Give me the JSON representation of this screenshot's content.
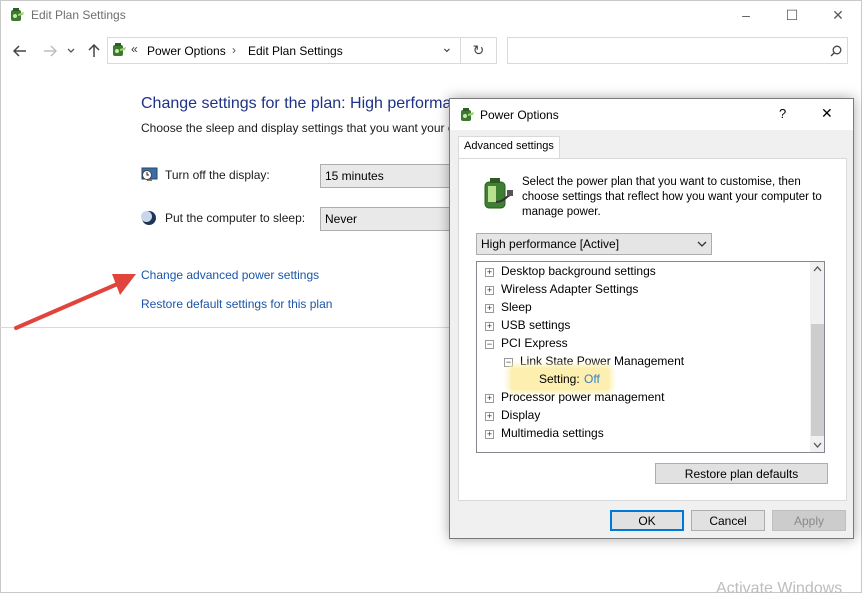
{
  "window": {
    "title": "Edit Plan Settings",
    "controls": {
      "minimize": "–",
      "maximize": "☐",
      "close": "✕"
    }
  },
  "addressbar": {
    "overflow": "«",
    "crumbs": [
      "Power Options",
      "Edit Plan Settings"
    ],
    "sep": "›",
    "dropdown": "⌄",
    "refresh": "↻",
    "search_placeholder": ""
  },
  "main": {
    "heading": "Change settings for the plan: High performance",
    "subtext": "Choose the sleep and display settings that you want your computer to use.",
    "display": {
      "label": "Turn off the display:",
      "value": "15 minutes"
    },
    "sleep": {
      "label": "Put the computer to sleep:",
      "value": "Never"
    },
    "links": {
      "advanced": "Change advanced power settings",
      "restore": "Restore default settings for this plan"
    }
  },
  "dialog": {
    "title": "Power Options",
    "help": "?",
    "close": "✕",
    "tab": "Advanced settings",
    "intro": "Select the power plan that you want to customise, then choose settings that reflect how you want your computer to manage power.",
    "plan_select": "High performance [Active]",
    "tree": [
      {
        "label": "Desktop background settings",
        "state": "+"
      },
      {
        "label": "Wireless Adapter Settings",
        "state": "+"
      },
      {
        "label": "Sleep",
        "state": "+"
      },
      {
        "label": "USB settings",
        "state": "+"
      },
      {
        "label": "PCI Express",
        "state": "−"
      },
      {
        "label": "Link State Power Management",
        "state": "−"
      },
      {
        "label": "Setting:",
        "value": "Off"
      },
      {
        "label": "Processor power management",
        "state": "+"
      },
      {
        "label": "Display",
        "state": "+"
      },
      {
        "label": "Multimedia settings",
        "state": "+"
      }
    ],
    "restore_defaults": "Restore plan defaults",
    "ok": "OK",
    "cancel": "Cancel",
    "apply": "Apply"
  },
  "watermark": "Activate Windows",
  "colors": {
    "heading": "#1e3287",
    "link": "#1b55a8",
    "highlight": "#fcefb0",
    "arrow": "#e0443c",
    "setting_value": "#3a7fc9"
  },
  "icons": [
    "power-options-icon",
    "back-arrow-icon",
    "forward-arrow-icon",
    "up-arrow-icon",
    "search-icon",
    "display-clock-icon",
    "sleep-moon-icon",
    "battery-plug-icon",
    "scroll-up-icon",
    "scroll-down-icon"
  ]
}
